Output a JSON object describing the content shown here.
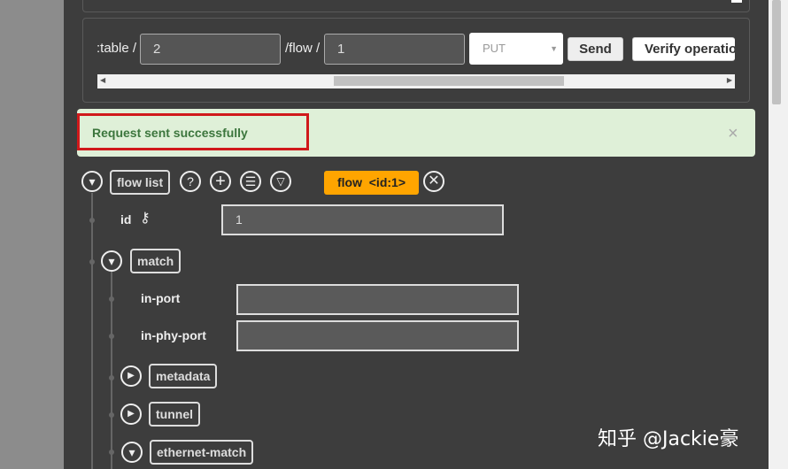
{
  "request": {
    "table_label": ":table /",
    "table_value": "2",
    "flow_label": "/flow /",
    "flow_value": "1",
    "method": "PUT",
    "send": "Send",
    "verify": "Verify operatio"
  },
  "alert": {
    "message": "Request sent successfully",
    "close": "×",
    "color": "#dff0d8",
    "text_color": "#3c763d"
  },
  "tree": {
    "root": {
      "label": "flow list",
      "badge": "flow  <id:1>",
      "badge_color": "#ffa500"
    },
    "id": {
      "label": "id",
      "value": "1"
    },
    "match": {
      "label": "match"
    },
    "in_port": {
      "label": "in-port",
      "value": ""
    },
    "in_phy_port": {
      "label": "in-phy-port",
      "value": ""
    },
    "metadata": {
      "label": "metadata"
    },
    "tunnel": {
      "label": "tunnel"
    },
    "ethernet_match": {
      "label": "ethernet-match"
    }
  },
  "icons": {
    "help": "question-circle",
    "add": "plus-circle",
    "list": "list-circle",
    "filter": "filter-circle",
    "close": "x-circle",
    "key": "key"
  },
  "watermark": "知乎 @Jackie豪"
}
